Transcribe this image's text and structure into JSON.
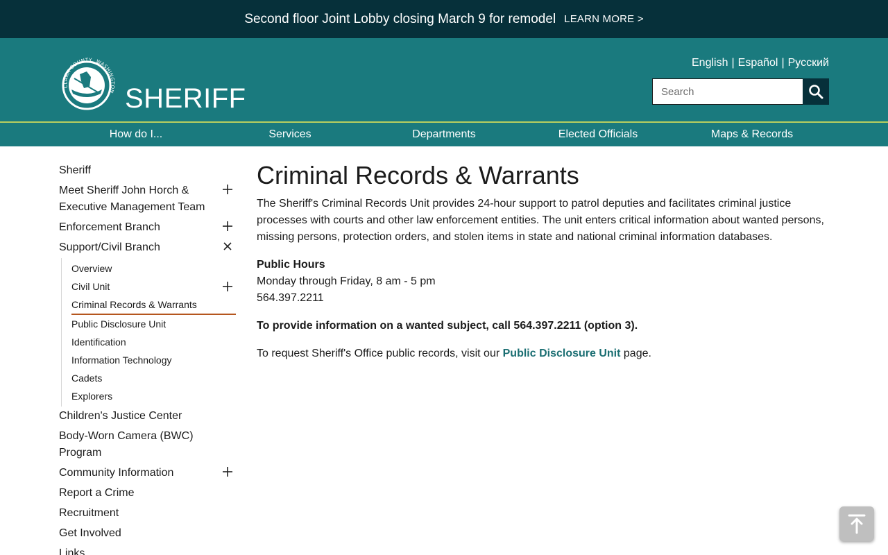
{
  "alert": {
    "text": "Second floor Joint Lobby closing March 9 for remodel",
    "link_label": "LEARN MORE >"
  },
  "header": {
    "brand": "SHERIFF",
    "logo_text": "CLARK COUNTY, WASHINGTON",
    "languages": [
      "English",
      "Español",
      "Русский"
    ],
    "separator": "|",
    "search_placeholder": "Search"
  },
  "nav": {
    "items": [
      "How do I...",
      "Services",
      "Departments",
      "Elected Officials",
      "Maps & Records"
    ]
  },
  "sidebar": {
    "items": [
      {
        "label": "Sheriff"
      },
      {
        "label": "Meet Sheriff John Horch & Executive Management Team",
        "toggle": "plus"
      },
      {
        "label": "Enforcement Branch",
        "toggle": "plus"
      },
      {
        "label": "Support/Civil Branch",
        "toggle": "close"
      }
    ],
    "sub_items": [
      {
        "label": "Overview"
      },
      {
        "label": "Civil Unit",
        "toggle": "plus"
      },
      {
        "label": "Criminal Records & Warrants",
        "active": true
      },
      {
        "label": "Public Disclosure Unit"
      },
      {
        "label": "Identification"
      },
      {
        "label": "Information Technology"
      },
      {
        "label": "Cadets"
      },
      {
        "label": "Explorers"
      }
    ],
    "items_after": [
      {
        "label": "Children's Justice Center"
      },
      {
        "label": "Body-Worn Camera (BWC) Program"
      },
      {
        "label": "Community Information",
        "toggle": "plus"
      },
      {
        "label": "Report a Crime"
      },
      {
        "label": "Recruitment"
      },
      {
        "label": "Get Involved"
      },
      {
        "label": "Links"
      }
    ]
  },
  "main": {
    "title": "Criminal Records & Warrants",
    "intro": "The Sheriff's Criminal Records Unit provides 24-hour support to patrol deputies and facilitates criminal justice processes with courts and other law enforcement entities. The unit enters critical information about wanted persons, missing persons, protection orders, and stolen items in state and national criminal information databases.",
    "hours_heading": "Public Hours",
    "hours": "Monday through Friday, 8 am - 5 pm",
    "phone": "564.397.2211",
    "wanted_notice": "To provide information on a wanted subject, call 564.397.2211 (option 3).",
    "records_prefix": "To request Sheriff's Office public records, visit our",
    "records_link": "Public Disclosure Unit",
    "records_suffix": "page."
  },
  "colors": {
    "alert_bg": "#06303a",
    "header_bg": "#1a7a7e",
    "accent_line": "#b9cf5f",
    "active_underline": "#b5561e",
    "link": "#1a6e72"
  },
  "icons": {
    "search": "search-icon",
    "plus": "plus-icon",
    "close": "close-icon",
    "back_to_top": "arrow-up-to-line-icon"
  }
}
